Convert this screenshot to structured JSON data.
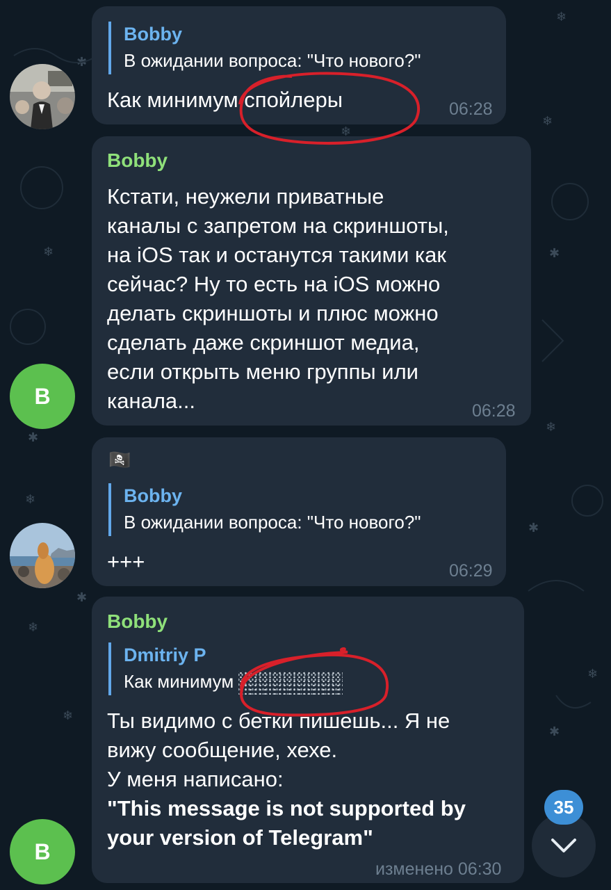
{
  "messages": [
    {
      "reply": {
        "name": "Bobby",
        "text": "В ожидании вопроса: \"Что нового?\""
      },
      "text": "Как минимум спойлеры",
      "time": "06:28"
    },
    {
      "sender": "Bobby",
      "text_lines": [
        "Кстати, неужели приватные",
        "каналы с запретом на скриншоты,",
        "на iOS так и останутся такими как",
        "сейчас? Ну то есть на iOS можно",
        "делать скриншоты и плюс можно",
        "сделать даже скриншот медиа,",
        "если открыть меню группы или",
        "канала..."
      ],
      "time": "06:28",
      "avatar_letter": "B"
    },
    {
      "emoji": "🏴‍☠️",
      "reply": {
        "name": "Bobby",
        "text": "В ожидании вопроса: \"Что нового?\""
      },
      "text": "+++",
      "time": "06:29"
    },
    {
      "sender": "Bobby",
      "reply": {
        "name": "Dmitriy P",
        "text": "Как минимум"
      },
      "text_lines": [
        "Ты видимо с бетки пишешь... Я не",
        "вижу сообщение, хехе.",
        "У меня написано:"
      ],
      "bold_lines": [
        "\"This message is not supported by",
        "your version of Telegram\""
      ],
      "time": "изменено 06:30",
      "avatar_letter": "B"
    }
  ],
  "unread_badge": "35",
  "colors": {
    "bubble": "#212d3b",
    "accent": "#62a8ea",
    "sender": "#8fe07a",
    "annotation": "#d8202a"
  },
  "icons": {
    "scroll_down": "chevron-down-icon",
    "pirate_flag": "pirate-flag-icon"
  }
}
